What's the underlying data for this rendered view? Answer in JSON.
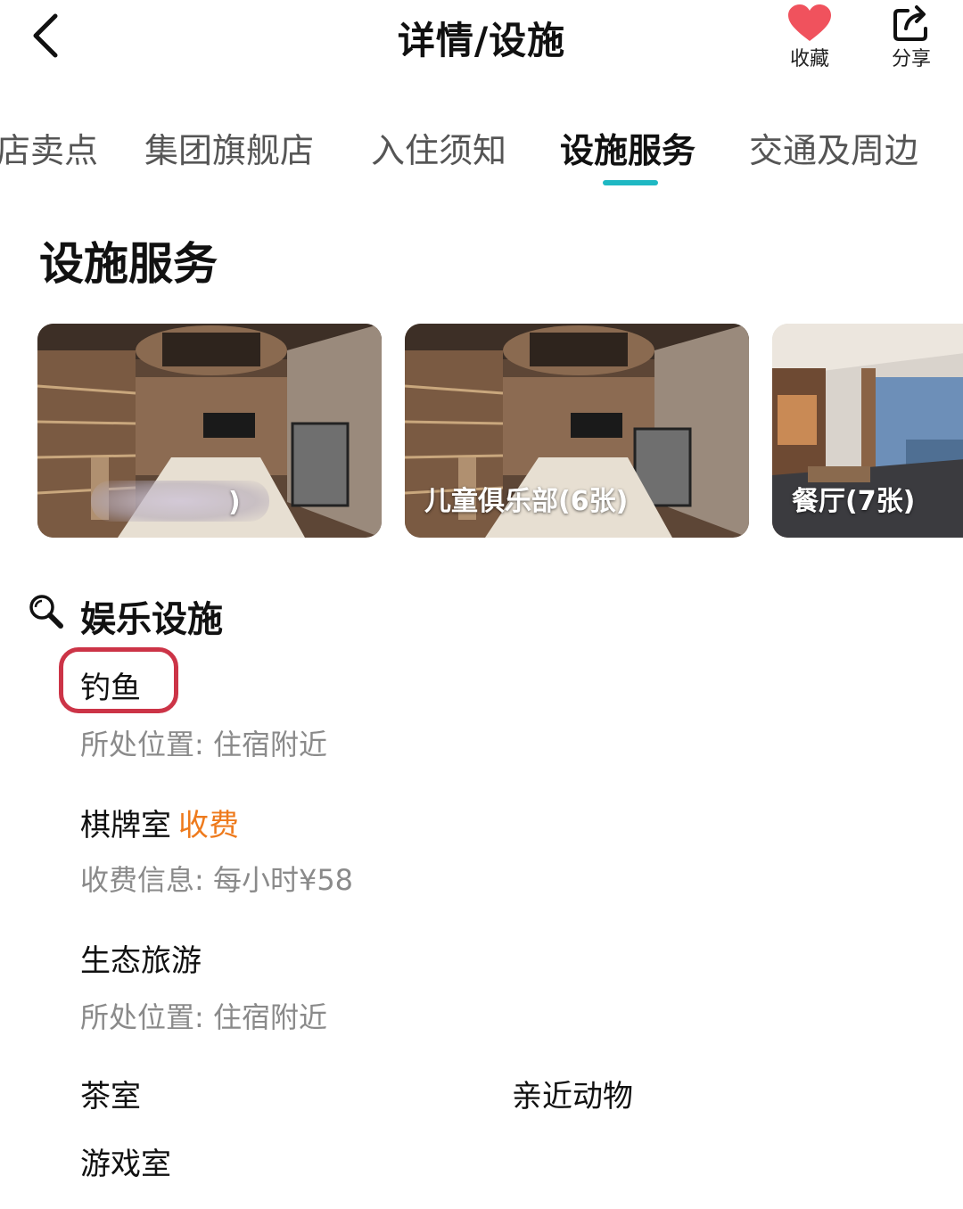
{
  "header": {
    "title": "详情/设施",
    "favorite_label": "收藏",
    "share_label": "分享",
    "favorite_color": "#f0525d"
  },
  "tabs": [
    {
      "label": "店卖点",
      "active": false
    },
    {
      "label": "集团旗舰店",
      "active": false
    },
    {
      "label": "入住须知",
      "active": false
    },
    {
      "label": "设施服务",
      "active": true
    },
    {
      "label": "交通及周边",
      "active": false
    }
  ],
  "accent_color": "#1fb8c3",
  "section": {
    "title": "设施服务"
  },
  "photos": [
    {
      "caption": ")",
      "scene": "library-room"
    },
    {
      "caption": "儿童俱乐部(6张)",
      "scene": "library-room"
    },
    {
      "caption": "餐厅(7张)",
      "scene": "restaurant"
    }
  ],
  "category": {
    "title": "娱乐设施",
    "icon": "search-icon"
  },
  "items": [
    {
      "name": "钓鱼",
      "detail": "所处位置: 住宿附近"
    },
    {
      "name": "棋牌室",
      "tag": "收费",
      "detail": "收费信息: 每小时¥58"
    },
    {
      "name": "生态旅游",
      "detail": "所处位置: 住宿附近"
    }
  ],
  "grid_items": [
    "茶室",
    "亲近动物",
    "游戏室"
  ],
  "highlight_color": "#cc3447",
  "fee_color": "#ee7a1c"
}
